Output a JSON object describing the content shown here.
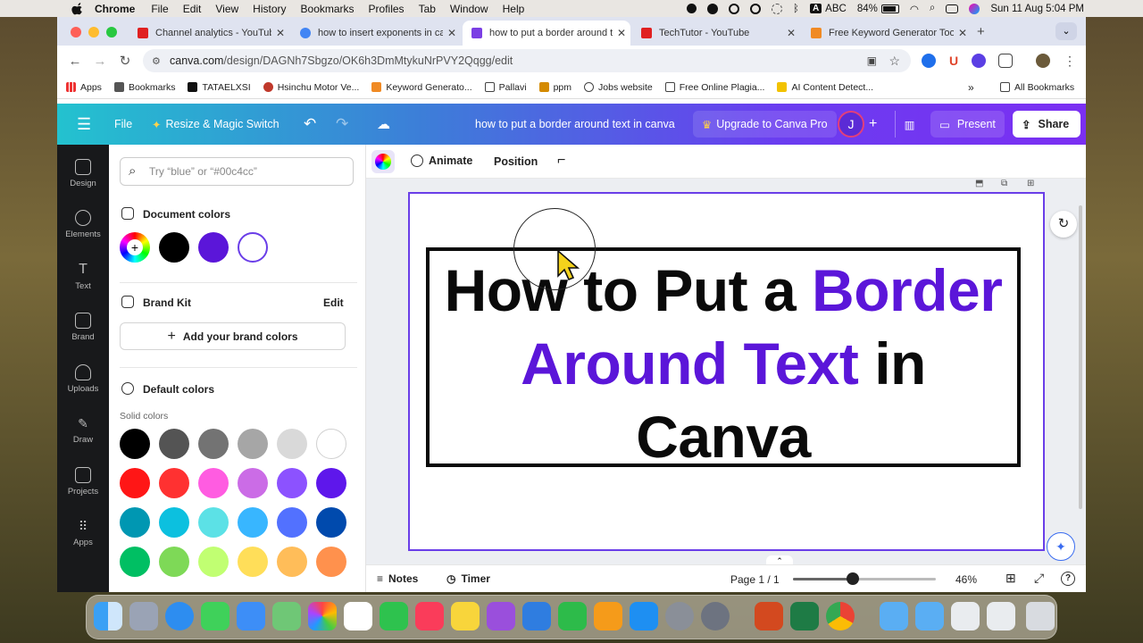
{
  "menubar": {
    "app": "Chrome",
    "items": [
      "File",
      "Edit",
      "View",
      "History",
      "Bookmarks",
      "Profiles",
      "Tab",
      "Window",
      "Help"
    ],
    "input_source": "ABC",
    "battery": "84%",
    "datetime": "Sun 11 Aug  5:04 PM"
  },
  "tabs": [
    {
      "title": "Channel analytics - YouTube S",
      "favicon_color": "#e02020"
    },
    {
      "title": "how to insert exponents in ca",
      "favicon_color": "#4285f4"
    },
    {
      "title": "how to put a border around te",
      "favicon_color": "#7b3fe4",
      "active": true
    },
    {
      "title": "TechTutor - YouTube",
      "favicon_color": "#e02020"
    },
    {
      "title": "Free Keyword Generator Tool:",
      "favicon_color": "#f08a24"
    }
  ],
  "address": {
    "url_host": "canva.com",
    "url_path": "/design/DAGNh7Sbgzo/OK6h3DmMtykuNrPVY2Qqgg/edit"
  },
  "bookmarks": [
    "Apps",
    "Bookmarks",
    "TATAELXSI",
    "Hsinchu Motor Ve...",
    "Keyword Generato...",
    "Pallavi",
    "ppm",
    "Jobs website",
    "Free Online Plagia...",
    "AI Content Detect..."
  ],
  "all_bookmarks": "All Bookmarks",
  "canva_top": {
    "file": "File",
    "resize": "Resize & Magic Switch",
    "doc_title": "how to put a border around text in canva",
    "upgrade": "Upgrade to Canva Pro",
    "avatar": "J",
    "present": "Present",
    "share": "Share"
  },
  "rail": [
    "Design",
    "Elements",
    "Text",
    "Brand",
    "Uploads",
    "Draw",
    "Projects",
    "Apps"
  ],
  "panel": {
    "search_placeholder": "Try “blue” or “#00c4cc”",
    "document_colors": "Document colors",
    "doc_swatches": [
      "#000000",
      "#5b16d9",
      "#ffffff"
    ],
    "brand_kit": "Brand Kit",
    "edit": "Edit",
    "add_brand": "Add your brand colors",
    "default_colors": "Default colors",
    "solid_colors": "Solid colors",
    "palette": [
      [
        "#000000",
        "#545454",
        "#737373",
        "#a6a6a6",
        "#d9d9d9",
        "#ffffff"
      ],
      [
        "#ff1616",
        "#ff3131",
        "#ff5ce1",
        "#cb6ce6",
        "#8c52ff",
        "#5e17eb"
      ],
      [
        "#0097b2",
        "#0cc0df",
        "#5ce1e6",
        "#38b6ff",
        "#5271ff",
        "#004aad"
      ],
      [
        "#00bf63",
        "#7ed957",
        "#c1ff72",
        "#ffde59",
        "#ffbd59",
        "#ff914d"
      ]
    ]
  },
  "toolbar": {
    "animate": "Animate",
    "position": "Position"
  },
  "canvas": {
    "line1_black": "How to Put a ",
    "line1_purple": "Border",
    "line2_purple": "Around Text",
    "line2_black": " in",
    "line3_black": "Canva"
  },
  "bottom": {
    "notes": "Notes",
    "timer": "Timer",
    "page": "Page 1 / 1",
    "zoom": "46%",
    "zoom_fraction": 0.42
  }
}
